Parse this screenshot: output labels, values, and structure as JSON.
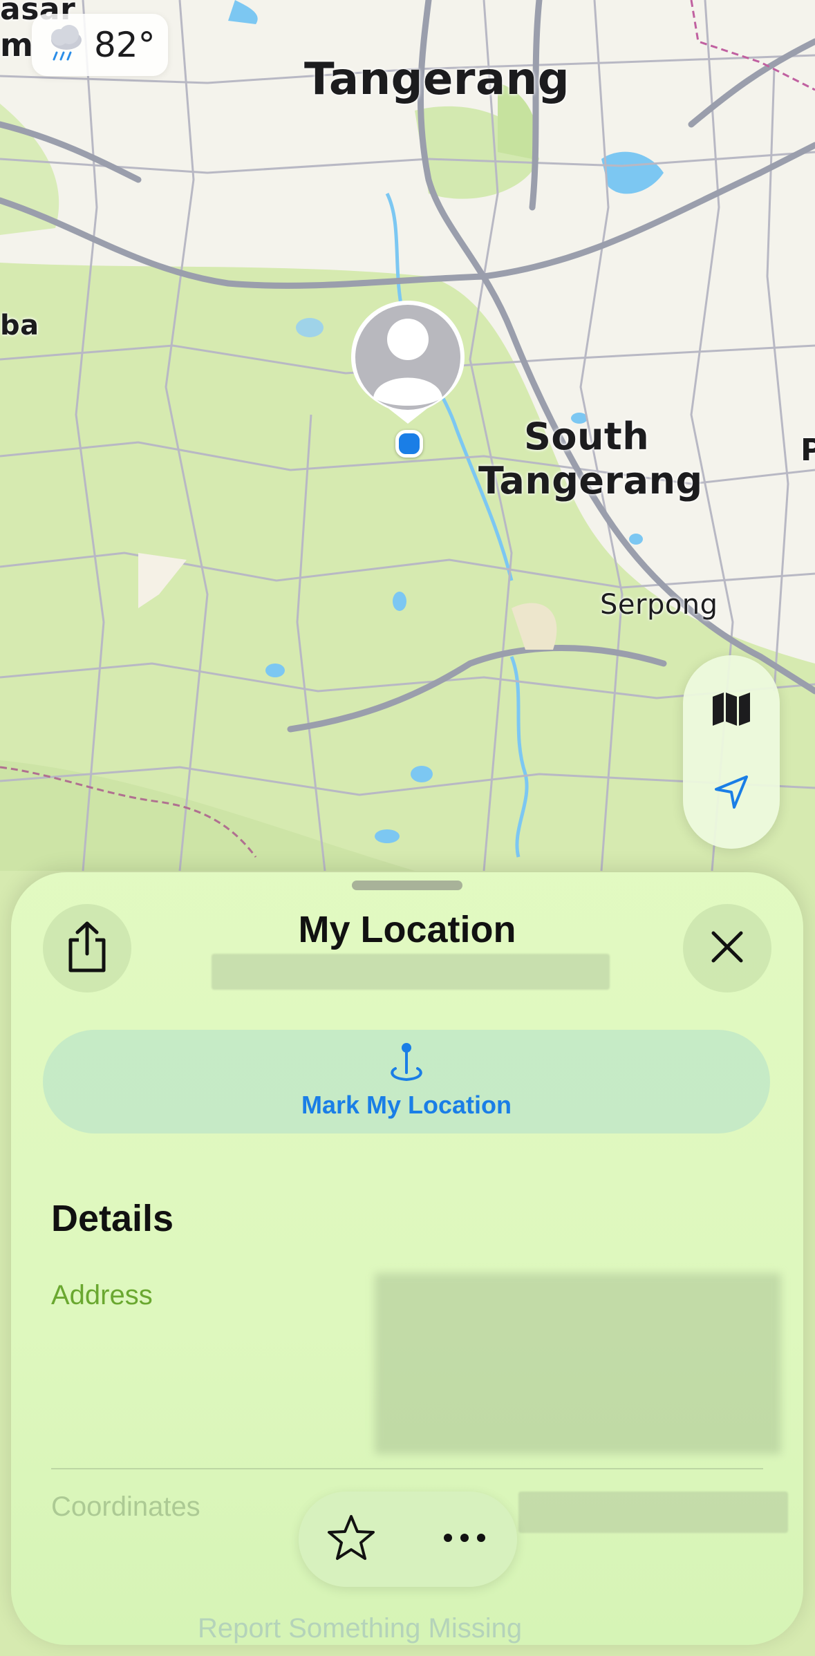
{
  "map": {
    "labels": {
      "tangerang": "Tangerang",
      "south_tangerang_1": "South",
      "south_tangerang_2": "Tangerang",
      "serpong": "Serpong",
      "edge_top_1": "asar",
      "edge_top_2": "m",
      "edge_left": "ba",
      "edge_right": "P"
    }
  },
  "weather": {
    "icon": "rain-cloud-icon",
    "temperature": "82°"
  },
  "map_controls": {
    "map_icon": "map-icon",
    "location_icon": "location-arrow-icon"
  },
  "sheet": {
    "title": "My Location",
    "share_icon": "share-icon",
    "close_icon": "close-icon",
    "mark_button": {
      "icon": "pin-icon",
      "label": "Mark My Location"
    },
    "details_heading": "Details",
    "address_label": "Address",
    "coordinates_label": "Coordinates",
    "report_label": "Report Something Missing",
    "bottom_bar": {
      "favorite_icon": "star-icon",
      "more_icon": "more-icon"
    }
  },
  "colors": {
    "accent": "#1a7ee6",
    "address_label": "#6aa830",
    "sheet_bg": "#e2fac2"
  }
}
